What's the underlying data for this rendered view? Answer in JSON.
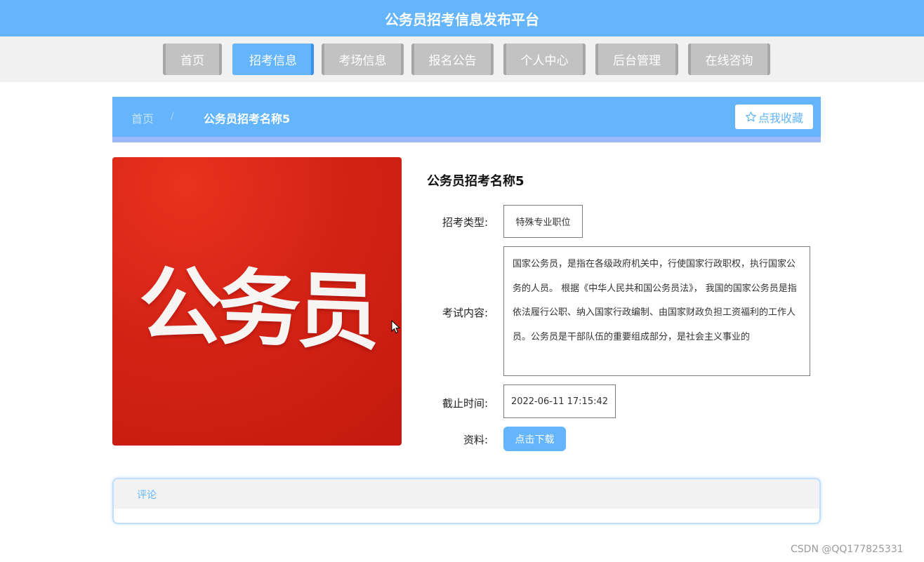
{
  "header": {
    "title": "公务员招考信息发布平台"
  },
  "nav": {
    "items": [
      {
        "label": "首页"
      },
      {
        "label": "招考信息"
      },
      {
        "label": "考场信息"
      },
      {
        "label": "报名公告"
      },
      {
        "label": "个人中心"
      },
      {
        "label": "后台管理"
      },
      {
        "label": "在线咨询"
      }
    ]
  },
  "breadcrumb": {
    "home": "首页",
    "separator": "/",
    "current": "公务员招考名称5"
  },
  "favorite": {
    "label": "点我收藏",
    "icon": "star-outline-icon"
  },
  "cover": {
    "text": "公务员"
  },
  "detail": {
    "title": "公务员招考名称5",
    "type_label": "招考类型:",
    "type_value": "特殊专业职位",
    "content_label": "考试内容:",
    "content_value": "国家公务员，是指在各级政府机关中，行使国家行政职权，执行国家公务的人员。 根据《中华人民共和国公务员法》， 我国的国家公务员是指依法履行公职、纳入国家行政编制、由国家财政负担工资福利的工作人员。公务员是干部队伍的重要组成部分，是社会主义事业的",
    "deadline_label": "截止时间:",
    "deadline_value": "2022-06-11 17:15:42",
    "material_label": "资料:",
    "download_label": "点击下载"
  },
  "comments": {
    "tab_label": "评论"
  },
  "watermark": "CSDN @QQ177825331",
  "colors": {
    "primary": "#64b5fb",
    "nav_inactive": "#c2c2c2",
    "cover_red": "#d42315"
  }
}
